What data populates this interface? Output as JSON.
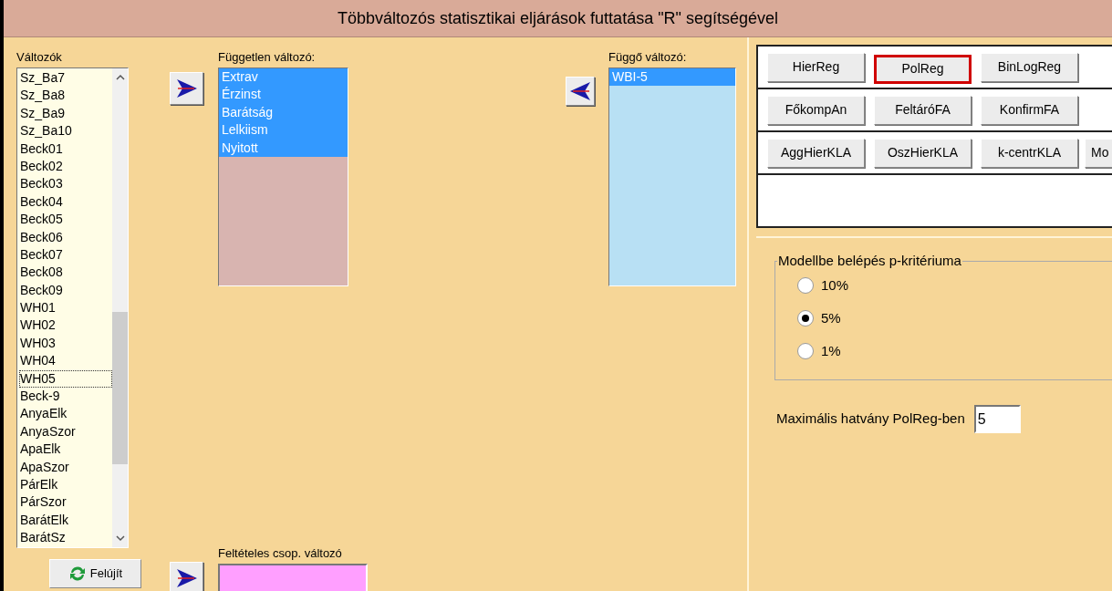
{
  "window": {
    "title": "Többváltozós statisztikai eljárások futtatása \"R\" segítségével"
  },
  "variables": {
    "label": "Változók",
    "items": [
      {
        "name": "Sz_Ba7",
        "focused": false
      },
      {
        "name": "Sz_Ba8",
        "focused": false
      },
      {
        "name": "Sz_Ba9",
        "focused": false
      },
      {
        "name": "Sz_Ba10",
        "focused": false
      },
      {
        "name": "Beck01",
        "focused": false
      },
      {
        "name": "Beck02",
        "focused": false
      },
      {
        "name": "Beck03",
        "focused": false
      },
      {
        "name": "Beck04",
        "focused": false
      },
      {
        "name": "Beck05",
        "focused": false
      },
      {
        "name": "Beck06",
        "focused": false
      },
      {
        "name": "Beck07",
        "focused": false
      },
      {
        "name": "Beck08",
        "focused": false
      },
      {
        "name": "Beck09",
        "focused": false
      },
      {
        "name": "WH01",
        "focused": false
      },
      {
        "name": "WH02",
        "focused": false
      },
      {
        "name": "WH03",
        "focused": false
      },
      {
        "name": "WH04",
        "focused": false
      },
      {
        "name": "WH05",
        "focused": true
      },
      {
        "name": "Beck-9",
        "focused": false
      },
      {
        "name": "AnyaElk",
        "focused": false
      },
      {
        "name": "AnyaSzor",
        "focused": false
      },
      {
        "name": "ApaElk",
        "focused": false
      },
      {
        "name": "ApaSzor",
        "focused": false
      },
      {
        "name": "PárElk",
        "focused": false
      },
      {
        "name": "PárSzor",
        "focused": false
      },
      {
        "name": "BarátElk",
        "focused": false
      },
      {
        "name": "BarátSz",
        "focused": false
      }
    ]
  },
  "refresh_button": {
    "label": "Felújít"
  },
  "independent": {
    "label": "Független változó:",
    "items": [
      {
        "name": "Extrav",
        "selected": true
      },
      {
        "name": "Érzinst",
        "selected": true
      },
      {
        "name": "Barátság",
        "selected": true
      },
      {
        "name": "Lelkiism",
        "selected": true
      },
      {
        "name": "Nyitott",
        "selected": true
      }
    ]
  },
  "conditional": {
    "label": "Feltételes csop. változó"
  },
  "dependent": {
    "label": "Függő változó:",
    "items": [
      {
        "name": "WBI-5",
        "selected": true
      }
    ]
  },
  "methods": [
    [
      {
        "label": "HierReg",
        "selected": false
      },
      {
        "label": "PolReg",
        "selected": true
      },
      {
        "label": "BinLogReg",
        "selected": false
      }
    ],
    [
      {
        "label": "FőkompAn",
        "selected": false
      },
      {
        "label": "FeltáróFA",
        "selected": false
      },
      {
        "label": "KonfirmFA",
        "selected": false
      }
    ],
    [
      {
        "label": "AggHierKLA",
        "selected": false
      },
      {
        "label": "OszHierKLA",
        "selected": false
      },
      {
        "label": "k-centrKLA",
        "selected": false
      },
      {
        "label": "Mo",
        "selected": false
      }
    ]
  ],
  "criterion": {
    "label": "Modellbe belépés p-kritériuma",
    "options": [
      {
        "label": "10%",
        "selected": false
      },
      {
        "label": "5%",
        "selected": true
      },
      {
        "label": "1%",
        "selected": false
      }
    ]
  },
  "max_power": {
    "label": "Maximális hatvány PolReg-ben",
    "value": "5"
  }
}
